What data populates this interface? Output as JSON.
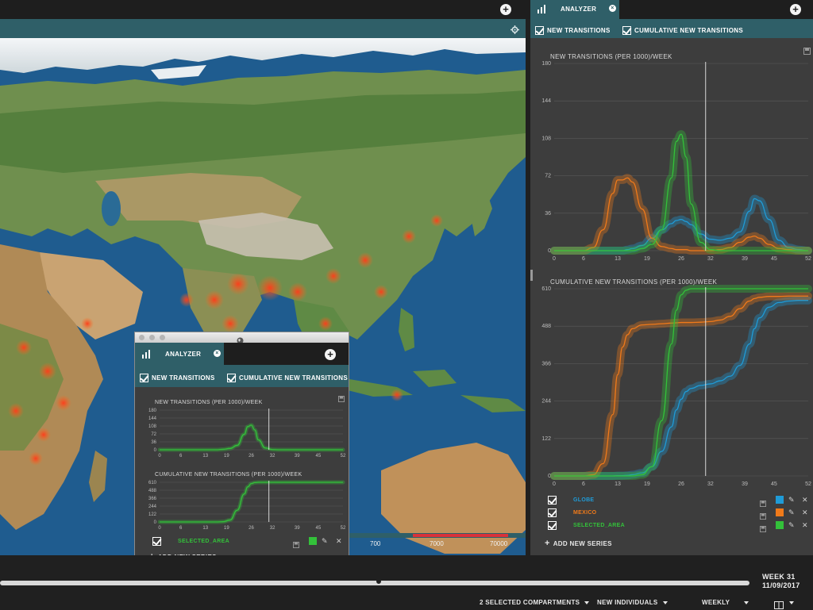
{
  "app": {
    "analyzer_tab_label": "ANALYZER",
    "new_transitions_label": "NEW TRANSITIONS",
    "cumulative_label": "CUMULATIVE NEW TRANSITIONS",
    "add_new_series_label": "ADD NEW SERIES"
  },
  "right_panel": {
    "chart1": {
      "title": "NEW TRANSITIONS (PER 1000)/WEEK",
      "y_ticks": [
        "180",
        "144",
        "108",
        "72",
        "36",
        "0"
      ],
      "x_ticks": [
        "0",
        "6",
        "13",
        "19",
        "26",
        "32",
        "39",
        "45",
        "52"
      ]
    },
    "chart2": {
      "title": "CUMULATIVE NEW TRANSITIONS (PER 1000)/WEEK",
      "y_ticks": [
        "610",
        "488",
        "366",
        "244",
        "122",
        "0"
      ],
      "x_ticks": [
        "0",
        "6",
        "13",
        "19",
        "26",
        "32",
        "39",
        "45",
        "52"
      ]
    },
    "series": [
      {
        "name": "GLOBE",
        "color": "#1f9bd7"
      },
      {
        "name": "MEXICO",
        "color": "#f07a1a"
      },
      {
        "name": "SELECTED_AREA",
        "color": "#33c13a"
      }
    ]
  },
  "floating": {
    "chart1": {
      "title": "NEW TRANSITIONS (PER 1000)/WEEK",
      "y_ticks": [
        "180",
        "144",
        "108",
        "72",
        "36",
        "0"
      ],
      "x_ticks": [
        "0",
        "6",
        "13",
        "19",
        "26",
        "32",
        "39",
        "45",
        "52"
      ]
    },
    "chart2": {
      "title": "CUMULATIVE NEW TRANSITIONS (PER 1000)/WEEK",
      "y_ticks": [
        "610",
        "488",
        "366",
        "244",
        "122",
        "0"
      ],
      "x_ticks": [
        "0",
        "6",
        "13",
        "19",
        "26",
        "32",
        "39",
        "45",
        "52"
      ]
    },
    "series": [
      {
        "name": "SELECTED_AREA",
        "color": "#33c13a"
      }
    ]
  },
  "colorbar": {
    "labels": [
      "700",
      "7000",
      "70000"
    ]
  },
  "timeline": {
    "week_label": "WEEK 31",
    "date_label": "11/09/2017",
    "position": 0.505
  },
  "bottom_controls": {
    "compartments": "2 SELECTED COMPARTMENTS",
    "individuals": "NEW INDIVIDUALS",
    "period": "WEEKLY"
  },
  "chart_data": [
    {
      "type": "line",
      "title": "NEW TRANSITIONS (PER 1000)/WEEK",
      "x": [
        0,
        3,
        6,
        8,
        10,
        12,
        13,
        14,
        15,
        16,
        18,
        20,
        22,
        24,
        25,
        26,
        27,
        28,
        30,
        32,
        34,
        36,
        38,
        40,
        41,
        42,
        44,
        46,
        48,
        50,
        52
      ],
      "ylim": [
        0,
        180
      ],
      "xlim": [
        0,
        52
      ],
      "series": [
        {
          "name": "GLOBE",
          "values": [
            0,
            0,
            0,
            0,
            0,
            0,
            0,
            0,
            1,
            2,
            5,
            12,
            20,
            26,
            29,
            30,
            28,
            25,
            16,
            11,
            10,
            12,
            18,
            38,
            50,
            48,
            30,
            10,
            3,
            1,
            0
          ]
        },
        {
          "name": "MEXICO",
          "values": [
            0,
            0,
            0,
            3,
            20,
            55,
            68,
            68,
            70,
            66,
            40,
            12,
            4,
            2,
            1,
            1,
            1,
            0,
            0,
            0,
            1,
            3,
            8,
            13,
            14,
            12,
            6,
            2,
            1,
            0,
            0
          ]
        },
        {
          "name": "SELECTED_AREA",
          "values": [
            0,
            0,
            0,
            0,
            0,
            0,
            0,
            0,
            0,
            0,
            2,
            6,
            20,
            70,
            105,
            112,
            90,
            45,
            8,
            1,
            0,
            0,
            0,
            0,
            0,
            0,
            0,
            0,
            0,
            0,
            0
          ]
        }
      ]
    },
    {
      "type": "line",
      "title": "CUMULATIVE NEW TRANSITIONS (PER 1000)/WEEK",
      "x": [
        0,
        3,
        6,
        8,
        10,
        12,
        13,
        14,
        15,
        16,
        18,
        20,
        22,
        24,
        25,
        26,
        27,
        28,
        30,
        32,
        34,
        36,
        38,
        40,
        41,
        42,
        44,
        46,
        48,
        50,
        52
      ],
      "ylim": [
        0,
        610
      ],
      "xlim": [
        0,
        52
      ],
      "series": [
        {
          "name": "GLOBE",
          "values": [
            0,
            0,
            0,
            0,
            0,
            0,
            1,
            1,
            2,
            4,
            10,
            30,
            80,
            160,
            215,
            250,
            275,
            285,
            295,
            300,
            310,
            325,
            360,
            430,
            480,
            515,
            550,
            565,
            570,
            572,
            572
          ]
        },
        {
          "name": "MEXICO",
          "values": [
            0,
            0,
            0,
            4,
            40,
            200,
            330,
            420,
            460,
            480,
            492,
            494,
            496,
            498,
            499,
            500,
            500,
            500,
            501,
            503,
            508,
            520,
            545,
            570,
            578,
            582,
            585,
            585,
            586,
            586,
            586
          ]
        },
        {
          "name": "SELECTED_AREA",
          "values": [
            0,
            0,
            0,
            0,
            0,
            0,
            0,
            0,
            0,
            0,
            4,
            30,
            180,
            430,
            540,
            590,
            605,
            610,
            610,
            610,
            610,
            610,
            610,
            610,
            610,
            610,
            610,
            610,
            610,
            610,
            610
          ]
        }
      ]
    }
  ]
}
